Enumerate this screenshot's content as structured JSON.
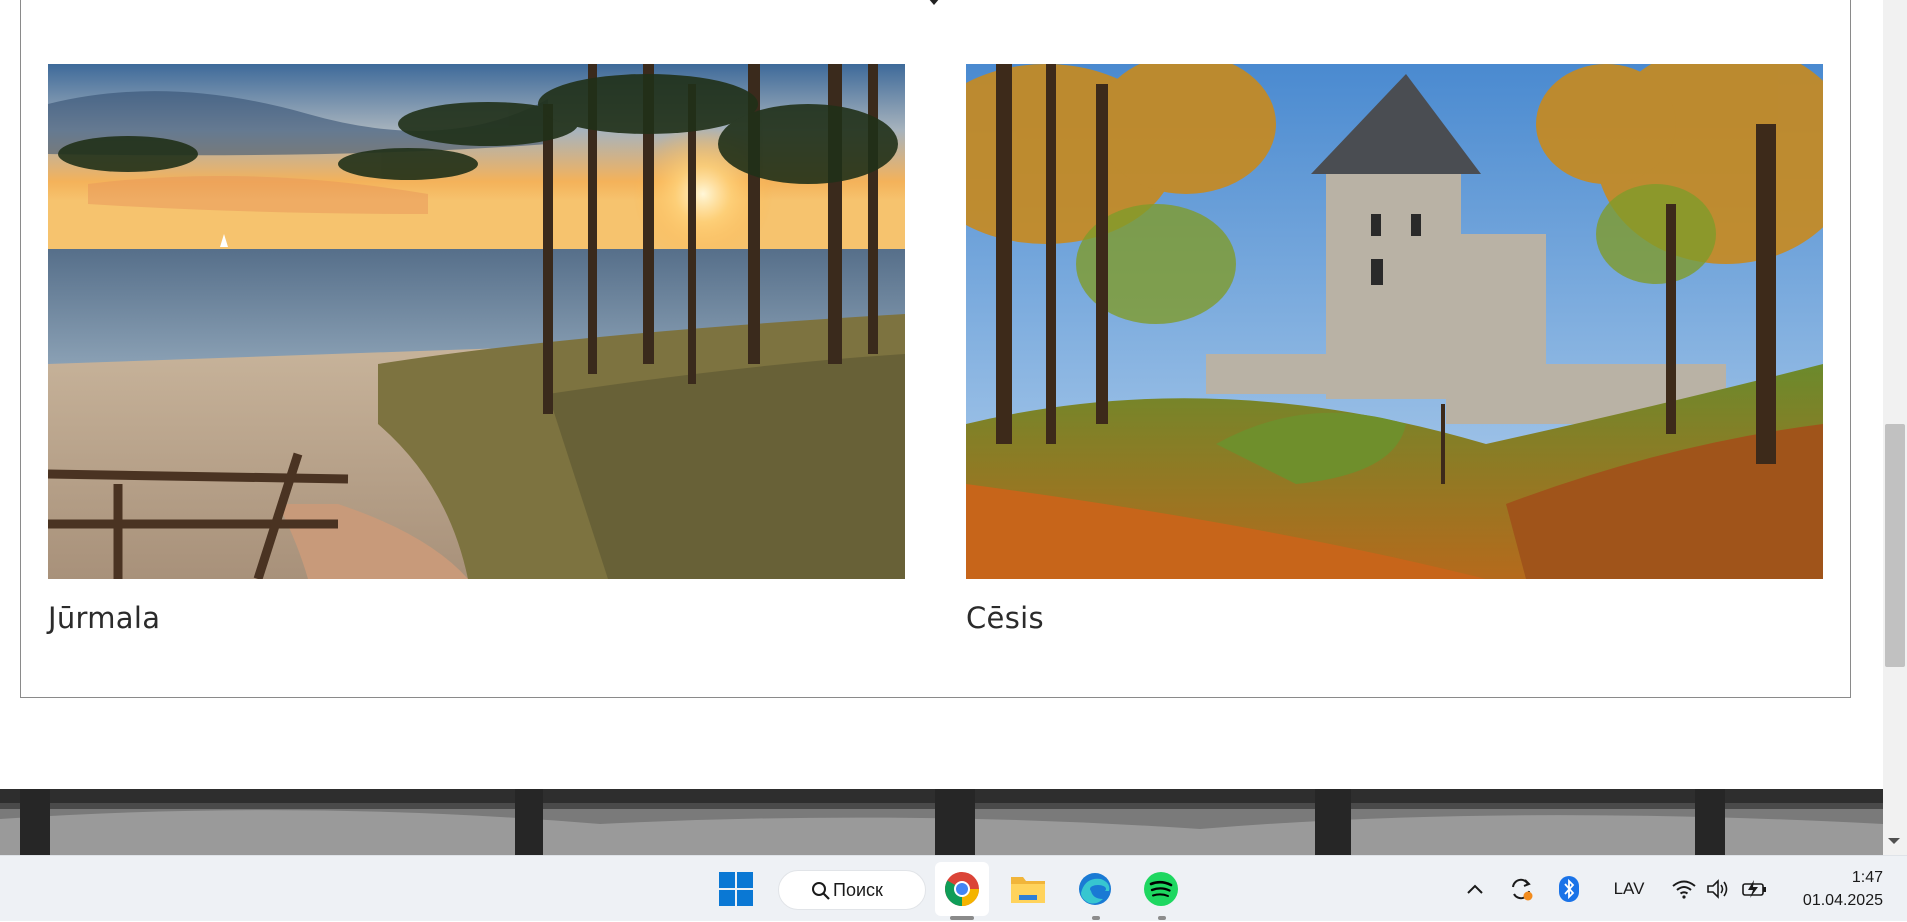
{
  "page": {
    "tiles": [
      {
        "caption": "Jūrmala",
        "image": "Jūrmala beach at sunset with pine trees and boardwalk"
      },
      {
        "caption": "Cēsis",
        "image": "Cēsis medieval castle in autumn"
      }
    ]
  },
  "taskbar": {
    "search_label": "Поиск",
    "language": "LAV",
    "time": "1:47",
    "date": "01.04.2025",
    "apps": [
      {
        "name": "chrome-icon",
        "active": true
      },
      {
        "name": "file-explorer-icon",
        "active": false
      },
      {
        "name": "edge-icon",
        "active": false
      },
      {
        "name": "spotify-icon",
        "active": false
      }
    ]
  },
  "colors": {
    "accent_blue": "#0078d4",
    "spotify_green": "#1ed760",
    "taskbar_bg": "#eef1f5"
  }
}
